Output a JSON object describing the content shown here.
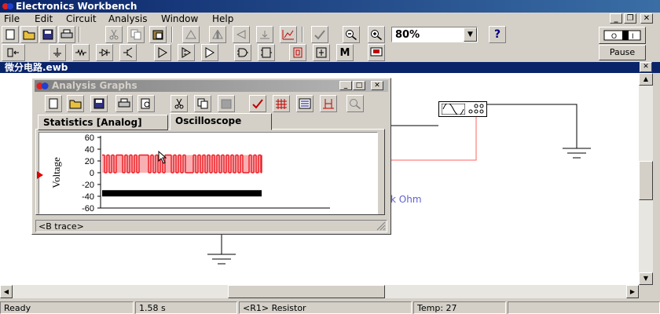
{
  "app": {
    "title": "Electronics Workbench"
  },
  "window_buttons": {
    "minimize": "_",
    "restore": "❐",
    "close": "✕"
  },
  "menu": [
    "File",
    "Edit",
    "Circuit",
    "Analysis",
    "Window",
    "Help"
  ],
  "toolbar": {
    "zoom_value": "80%",
    "help_label": "?",
    "pause_label": "Pause"
  },
  "document": {
    "title": "微分电路.ewb"
  },
  "circuit": {
    "resistor_unit_label": "k Ohm"
  },
  "analysis_window": {
    "title": "Analysis Graphs",
    "tabs": [
      "Statistics [Analog]",
      "Oscilloscope"
    ],
    "active_tab": "Oscilloscope",
    "trace_label": "<B trace>"
  },
  "chart_data": {
    "type": "line",
    "ylabel": "Voltage",
    "yticks": [
      "60",
      "40",
      "20",
      "0",
      "-20",
      "-40",
      "-60"
    ],
    "ylim": [
      -60,
      60
    ],
    "series": [
      {
        "name": "",
        "color": "#ee1c24",
        "shape": "square-pulse-train",
        "low": 0,
        "high": 30
      },
      {
        "name": "",
        "color": "#000000",
        "shape": "flat",
        "value": -35
      }
    ],
    "marker_y": 0,
    "grid": false
  },
  "status": {
    "state": "Ready",
    "time": "1.58 s",
    "component": "<R1> Resistor",
    "temperature": "Temp:  27"
  }
}
